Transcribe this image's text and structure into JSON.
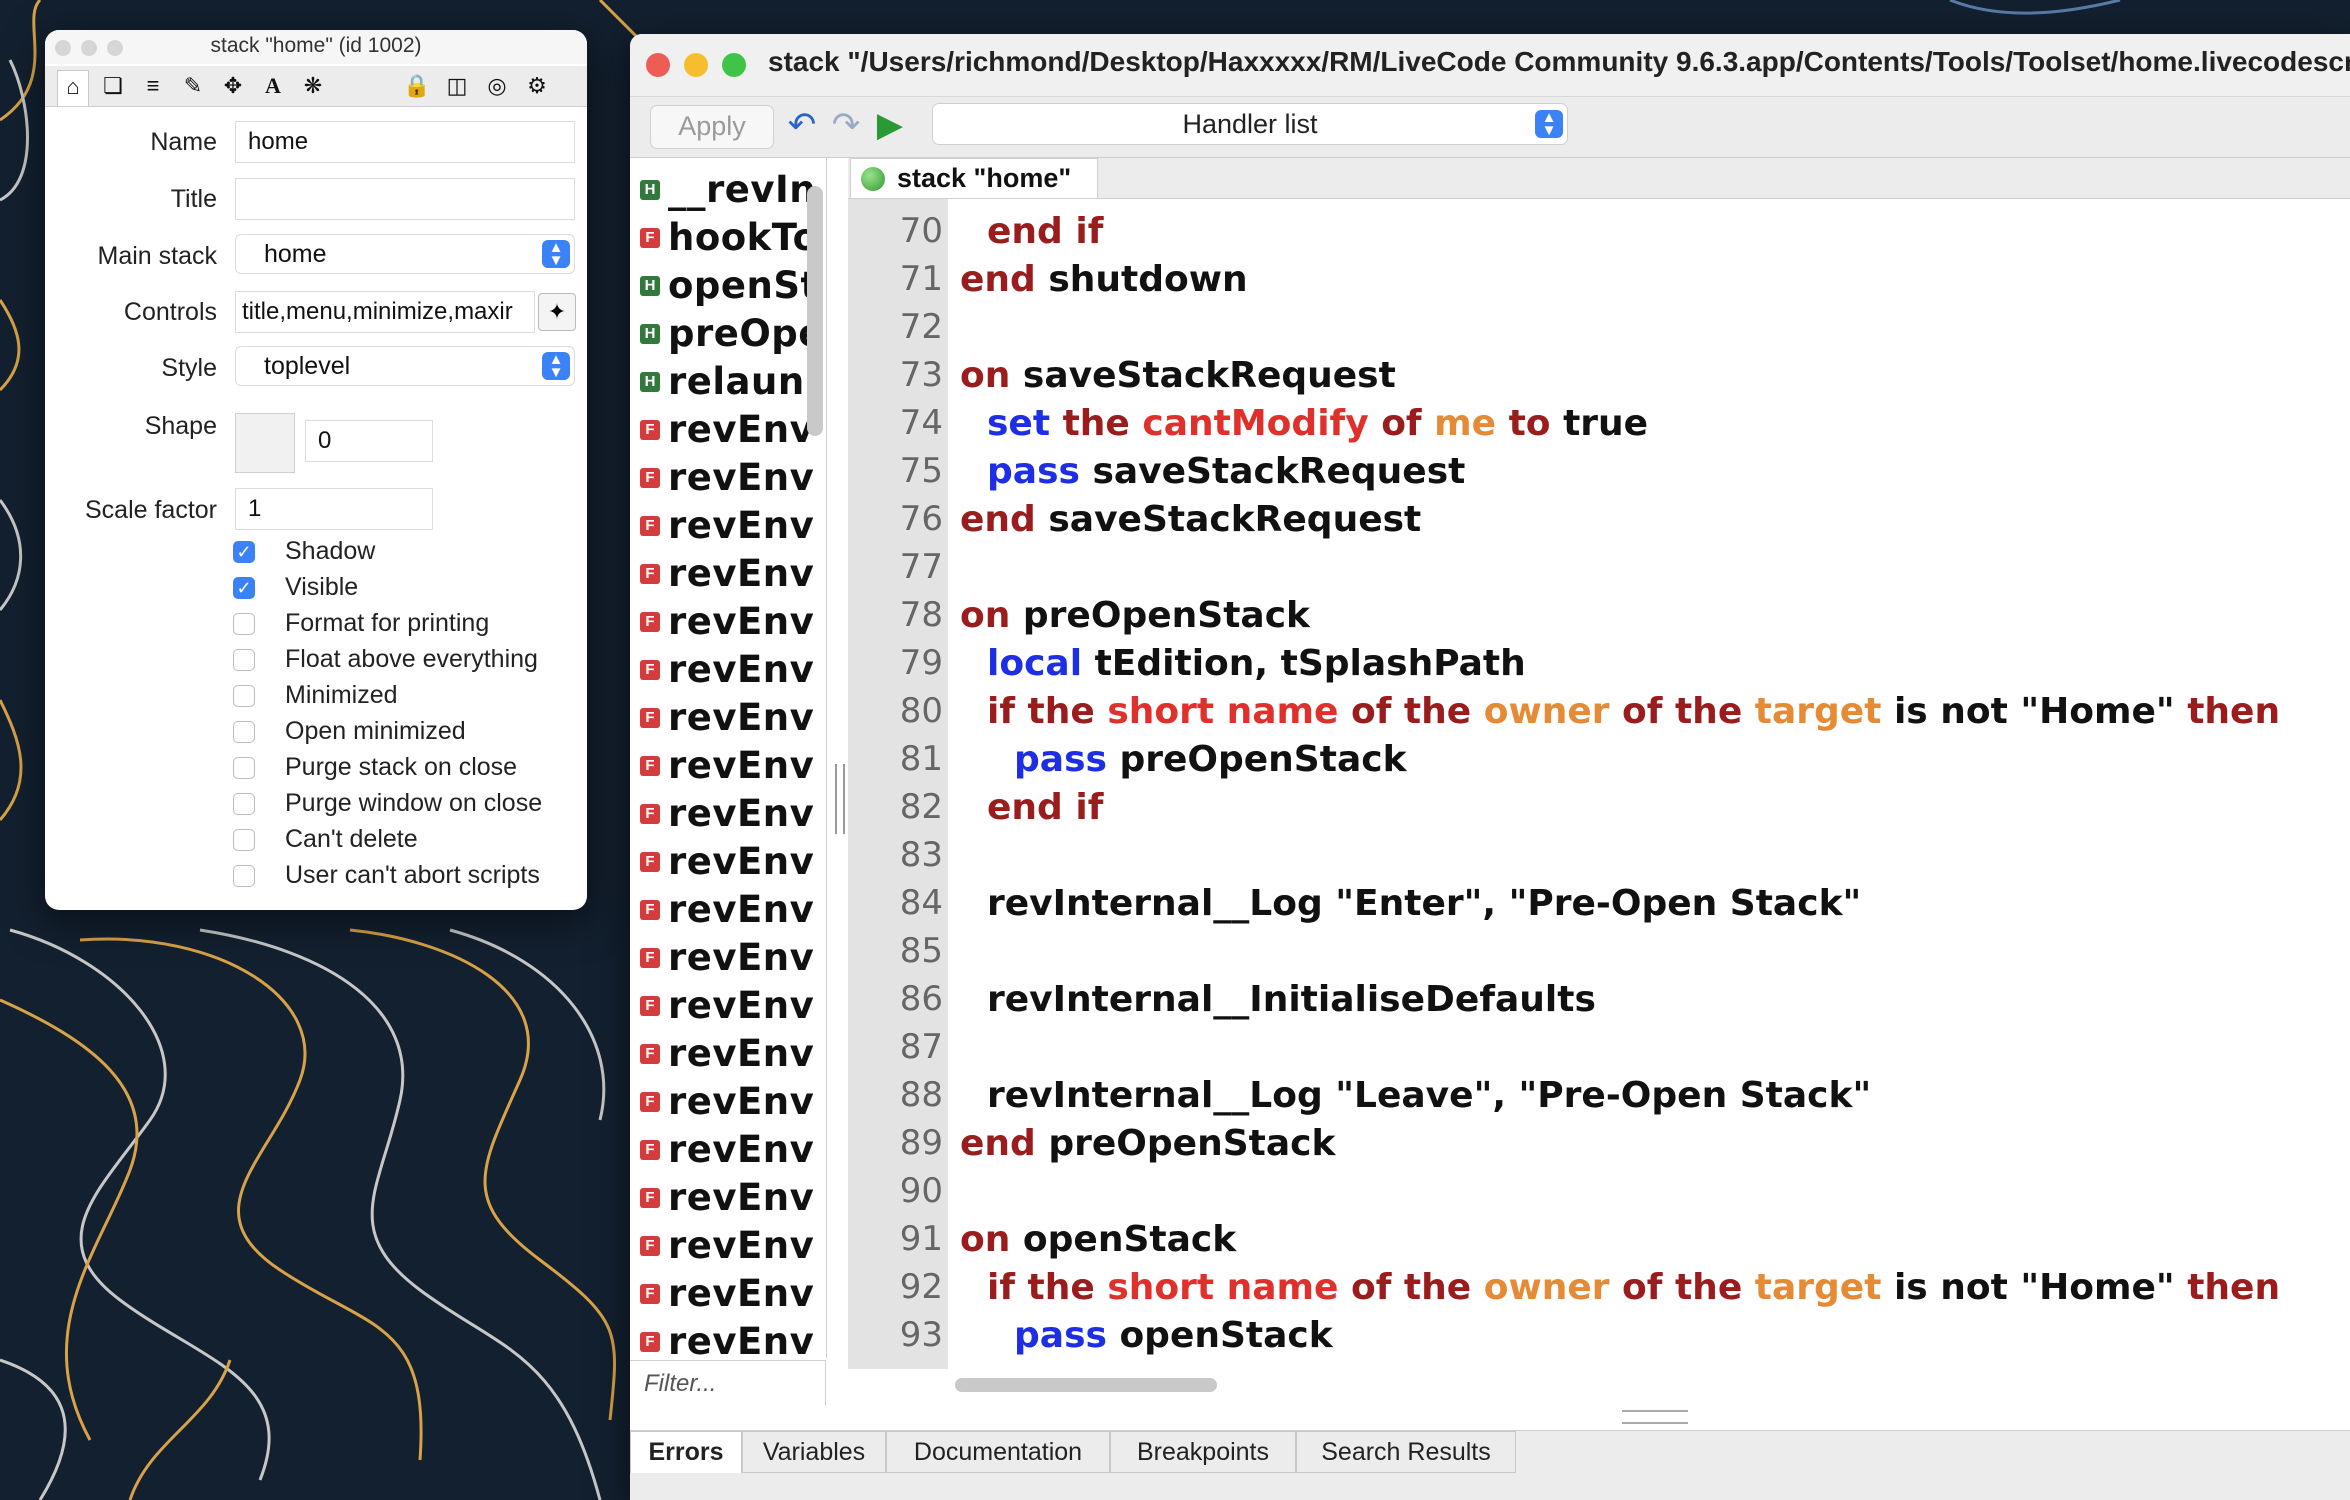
{
  "inspector": {
    "title": "stack \"home\" (id 1002)",
    "toolbar_icons": [
      "home-icon",
      "copy-icon",
      "database-icon",
      "pencil-icon",
      "move-icon",
      "text-icon",
      "gears-icon",
      "lock-icon",
      "geometry-icon",
      "target-icon",
      "settings-icon"
    ],
    "labels": {
      "name": "Name",
      "title": "Title",
      "main_stack": "Main stack",
      "controls": "Controls",
      "style": "Style",
      "shape": "Shape",
      "scale_factor": "Scale factor"
    },
    "values": {
      "name": "home",
      "title": "",
      "main_stack": "home",
      "controls": "title,menu,minimize,maxir",
      "style": "toplevel",
      "shape": "0",
      "scale_factor": "1"
    },
    "checkboxes": [
      {
        "label": "Shadow",
        "checked": true
      },
      {
        "label": "Visible",
        "checked": true
      },
      {
        "label": "Format for printing",
        "checked": false
      },
      {
        "label": "Float above everything",
        "checked": false
      },
      {
        "label": "Minimized",
        "checked": false
      },
      {
        "label": "Open minimized",
        "checked": false
      },
      {
        "label": "Purge stack on close",
        "checked": false
      },
      {
        "label": "Purge window on close",
        "checked": false
      },
      {
        "label": "Can't delete",
        "checked": false
      },
      {
        "label": "User can't abort scripts",
        "checked": false
      }
    ]
  },
  "editor": {
    "title": "stack \"/Users/richmond/Desktop/Haxxxxx/RM/LiveCode Community 9.6.3.app/Contents/Tools/Toolset/home.livecodescript",
    "toolbar": {
      "apply_label": "Apply",
      "handler_list_label": "Handler list"
    },
    "handlers": [
      {
        "badge": "H",
        "name": "__revIn"
      },
      {
        "badge": "F",
        "name": "hookTo"
      },
      {
        "badge": "H",
        "name": "openSt"
      },
      {
        "badge": "H",
        "name": "preOpe"
      },
      {
        "badge": "H",
        "name": "relaun"
      },
      {
        "badge": "F",
        "name": "revEnv"
      },
      {
        "badge": "F",
        "name": "revEnv"
      },
      {
        "badge": "F",
        "name": "revEnv"
      },
      {
        "badge": "F",
        "name": "revEnv"
      },
      {
        "badge": "F",
        "name": "revEnv"
      },
      {
        "badge": "F",
        "name": "revEnv"
      },
      {
        "badge": "F",
        "name": "revEnv"
      },
      {
        "badge": "F",
        "name": "revEnv"
      },
      {
        "badge": "F",
        "name": "revEnv"
      },
      {
        "badge": "F",
        "name": "revEnv"
      },
      {
        "badge": "F",
        "name": "revEnv"
      },
      {
        "badge": "F",
        "name": "revEnv"
      },
      {
        "badge": "F",
        "name": "revEnv"
      },
      {
        "badge": "F",
        "name": "revEnv"
      },
      {
        "badge": "F",
        "name": "revEnv"
      },
      {
        "badge": "F",
        "name": "revEnv"
      },
      {
        "badge": "F",
        "name": "revEnv"
      },
      {
        "badge": "F",
        "name": "revEnv"
      },
      {
        "badge": "F",
        "name": "revEnv"
      },
      {
        "badge": "F",
        "name": "revEnv"
      }
    ],
    "filter_placeholder": "Filter...",
    "script_tab": "stack \"home\"",
    "code_lines": [
      {
        "n": "70",
        "indent": 1,
        "tokens": [
          {
            "t": "end if",
            "c": "k-dark"
          }
        ]
      },
      {
        "n": "71",
        "indent": 0,
        "tokens": [
          {
            "t": "end ",
            "c": "k-dark"
          },
          {
            "t": "shutdown",
            "c": ""
          }
        ]
      },
      {
        "n": "72",
        "indent": 0,
        "tokens": []
      },
      {
        "n": "73",
        "indent": 0,
        "tokens": [
          {
            "t": "on ",
            "c": "k-dark"
          },
          {
            "t": "saveStackRequest",
            "c": ""
          }
        ]
      },
      {
        "n": "74",
        "indent": 1,
        "tokens": [
          {
            "t": "set ",
            "c": "k-blue"
          },
          {
            "t": "the ",
            "c": "k-dark"
          },
          {
            "t": "cantModify",
            "c": "k-red"
          },
          {
            "t": " of ",
            "c": "k-dark"
          },
          {
            "t": "me",
            "c": "k-orange"
          },
          {
            "t": " to ",
            "c": "k-dark"
          },
          {
            "t": "true",
            "c": ""
          }
        ]
      },
      {
        "n": "75",
        "indent": 1,
        "tokens": [
          {
            "t": "pass ",
            "c": "k-blue"
          },
          {
            "t": "saveStackRequest",
            "c": ""
          }
        ]
      },
      {
        "n": "76",
        "indent": 0,
        "tokens": [
          {
            "t": "end ",
            "c": "k-dark"
          },
          {
            "t": "saveStackRequest",
            "c": ""
          }
        ]
      },
      {
        "n": "77",
        "indent": 0,
        "tokens": []
      },
      {
        "n": "78",
        "indent": 0,
        "tokens": [
          {
            "t": "on ",
            "c": "k-dark"
          },
          {
            "t": "preOpenStack",
            "c": ""
          }
        ]
      },
      {
        "n": "79",
        "indent": 1,
        "tokens": [
          {
            "t": "local ",
            "c": "k-blue"
          },
          {
            "t": "tEdition, tSplashPath",
            "c": ""
          }
        ]
      },
      {
        "n": "80",
        "indent": 1,
        "tokens": [
          {
            "t": "if the ",
            "c": "k-dark"
          },
          {
            "t": "short name",
            "c": "k-red"
          },
          {
            "t": " of the ",
            "c": "k-dark"
          },
          {
            "t": "owner",
            "c": "k-orange"
          },
          {
            "t": " of the ",
            "c": "k-dark"
          },
          {
            "t": "target",
            "c": "k-orange"
          },
          {
            "t": " is not \"Home\" ",
            "c": ""
          },
          {
            "t": "then",
            "c": "k-dark"
          }
        ]
      },
      {
        "n": "81",
        "indent": 2,
        "tokens": [
          {
            "t": "pass ",
            "c": "k-blue"
          },
          {
            "t": "preOpenStack",
            "c": ""
          }
        ]
      },
      {
        "n": "82",
        "indent": 1,
        "tokens": [
          {
            "t": "end if",
            "c": "k-dark"
          }
        ]
      },
      {
        "n": "83",
        "indent": 0,
        "tokens": []
      },
      {
        "n": "84",
        "indent": 1,
        "tokens": [
          {
            "t": "revInternal__Log \"Enter\", \"Pre-Open Stack\"",
            "c": ""
          }
        ]
      },
      {
        "n": "85",
        "indent": 0,
        "tokens": []
      },
      {
        "n": "86",
        "indent": 1,
        "tokens": [
          {
            "t": "revInternal__InitialiseDefaults",
            "c": ""
          }
        ]
      },
      {
        "n": "87",
        "indent": 0,
        "tokens": []
      },
      {
        "n": "88",
        "indent": 1,
        "tokens": [
          {
            "t": "revInternal__Log \"Leave\", \"Pre-Open Stack\"",
            "c": ""
          }
        ]
      },
      {
        "n": "89",
        "indent": 0,
        "tokens": [
          {
            "t": "end ",
            "c": "k-dark"
          },
          {
            "t": "preOpenStack",
            "c": ""
          }
        ]
      },
      {
        "n": "90",
        "indent": 0,
        "tokens": []
      },
      {
        "n": "91",
        "indent": 0,
        "tokens": [
          {
            "t": "on ",
            "c": "k-dark"
          },
          {
            "t": "openStack",
            "c": ""
          }
        ]
      },
      {
        "n": "92",
        "indent": 1,
        "tokens": [
          {
            "t": "if the ",
            "c": "k-dark"
          },
          {
            "t": "short name",
            "c": "k-red"
          },
          {
            "t": " of the ",
            "c": "k-dark"
          },
          {
            "t": "owner",
            "c": "k-orange"
          },
          {
            "t": " of the ",
            "c": "k-dark"
          },
          {
            "t": "target",
            "c": "k-orange"
          },
          {
            "t": " is not \"Home\" ",
            "c": ""
          },
          {
            "t": "then",
            "c": "k-dark"
          }
        ]
      },
      {
        "n": "93",
        "indent": 2,
        "tokens": [
          {
            "t": "pass ",
            "c": "k-blue"
          },
          {
            "t": "openStack",
            "c": ""
          }
        ]
      }
    ],
    "bottom_tabs": [
      "Errors",
      "Variables",
      "Documentation",
      "Breakpoints",
      "Search Results"
    ]
  },
  "colors": {
    "keyword_dark_red": "#9b1c1c",
    "keyword_blue": "#1d2ee6",
    "property_red": "#e0302b",
    "object_orange": "#e58a35",
    "checkbox_blue": "#3b82f6"
  }
}
